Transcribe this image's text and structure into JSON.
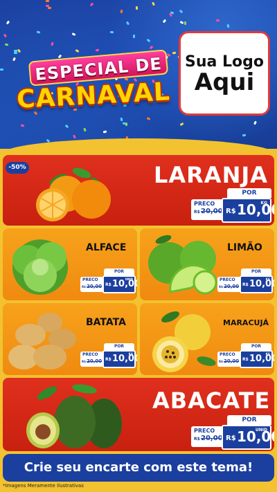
{
  "header": {
    "title_line1": "ESPECIAL DE",
    "title_line2": "CARNAVAL",
    "logo_line1": "Sua Logo",
    "logo_line2": "Aqui"
  },
  "badge": {
    "discount": "-50%"
  },
  "products": {
    "laranja": {
      "name": "LARANJA",
      "por": "POR",
      "preco": "PRECO",
      "old_prefix": "R$",
      "old": "20,00",
      "currency": "R$",
      "price": "10,00",
      "unit": "KG"
    },
    "alface": {
      "name": "ALFACE",
      "por": "POR",
      "preco": "PRECO",
      "old_prefix": "R$",
      "old": "20,00",
      "currency": "R$",
      "price": "10,00",
      "unit": "UNID"
    },
    "limao": {
      "name": "LIMÃO",
      "por": "POR",
      "preco": "PRECO",
      "old_prefix": "R$",
      "old": "20,00",
      "currency": "R$",
      "price": "10,00",
      "unit": "KG"
    },
    "batata": {
      "name": "BATATA",
      "por": "POR",
      "preco": "PRECO",
      "old_prefix": "R$",
      "old": "20,00",
      "currency": "R$",
      "price": "10,00",
      "unit": "KG"
    },
    "maracuja": {
      "name": "MARACUJÁ",
      "por": "POR",
      "preco": "PRECO",
      "old_prefix": "R$",
      "old": "20,00",
      "currency": "R$",
      "price": "10,00",
      "unit": "KG"
    },
    "abacate": {
      "name": "ABACATE",
      "por": "POR",
      "preco": "PRECO",
      "old_prefix": "R$",
      "old": "20,00",
      "currency": "R$",
      "price": "10,00",
      "unit": "UNID"
    }
  },
  "footer": {
    "cta": "Crie seu encarte com este tema!",
    "disclaimer": "*Imagens Meramente Ilustrativas"
  },
  "colors": {
    "blue": "#1b3f9e",
    "red": "#d4261a",
    "orange": "#f5981a",
    "yellow": "#f2c230"
  }
}
